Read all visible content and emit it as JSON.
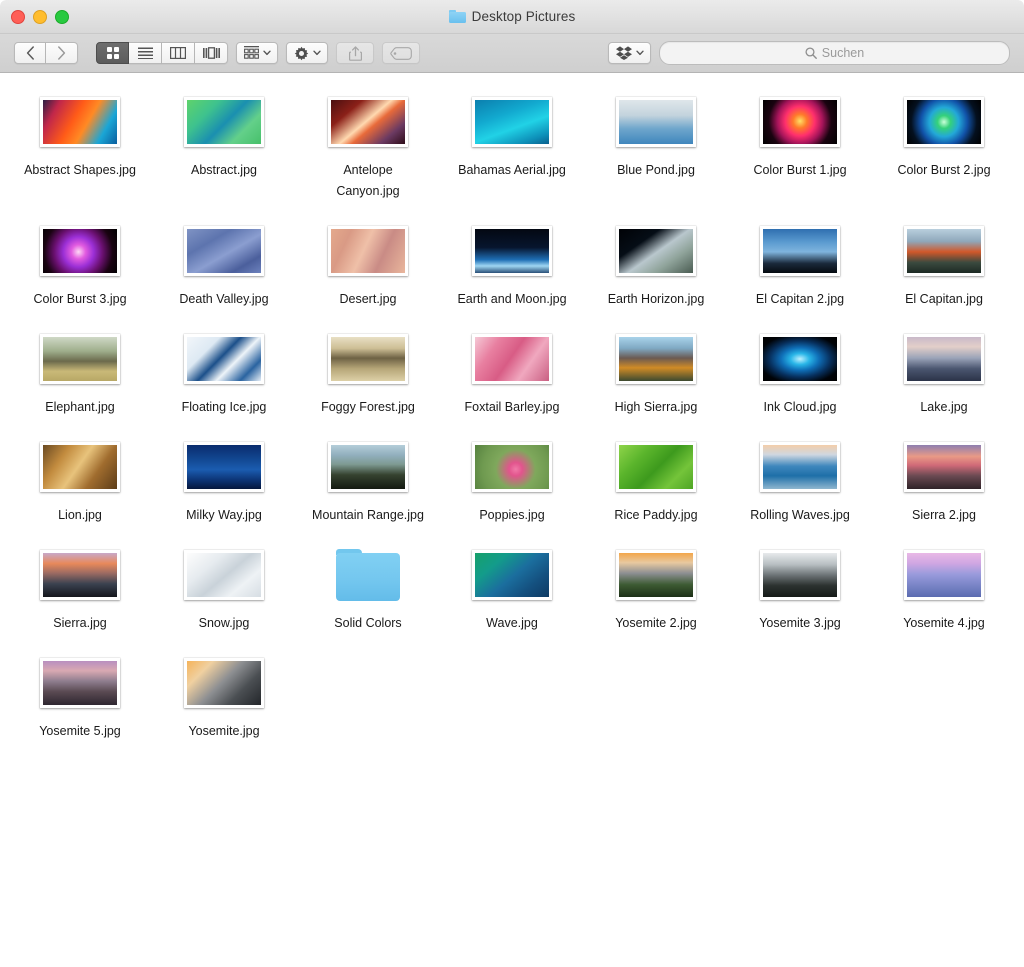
{
  "window": {
    "title": "Desktop Pictures",
    "traffic_lights": [
      "close",
      "minimize",
      "maximize"
    ]
  },
  "toolbar": {
    "back_label": "‹",
    "forward_label": "›",
    "view_modes": [
      {
        "name": "icon-view",
        "selected": true
      },
      {
        "name": "list-view",
        "selected": false
      },
      {
        "name": "column-view",
        "selected": false
      },
      {
        "name": "coverflow-view",
        "selected": false
      }
    ],
    "arrange_label": "",
    "action_label": "",
    "share_label": "",
    "tags_label": "",
    "dropbox_label": ""
  },
  "search": {
    "placeholder": "Suchen"
  },
  "files": [
    {
      "name": "Abstract Shapes.jpg",
      "type": "image",
      "css": "linear-gradient(120deg,#2b1e44 0%,#c1274a 18%,#ff5b18 42%,#ff8a24 58%,#1aa6d6 80%,#0b5e9e 100%)"
    },
    {
      "name": "Abstract.jpg",
      "type": "image",
      "css": "linear-gradient(135deg,#5fd36b 0%,#3ec28e 28%,#1a8fb0 52%,#63d08a 74%,#47c06a 100%)"
    },
    {
      "name": "Antelope Canyon.jpg",
      "type": "image",
      "css": "linear-gradient(140deg,#4a0f10 0%,#8b2018 25%,#ffd9b0 48%,#e86a3a 58%,#6b3a62 80%,#2e0c18 100%)"
    },
    {
      "name": "Bahamas Aerial.jpg",
      "type": "image",
      "css": "linear-gradient(160deg,#0b7fae 0%,#12a9cf 35%,#21d2e6 60%,#0d8fb8 85%,#0a5f8d 100%)"
    },
    {
      "name": "Blue Pond.jpg",
      "type": "image",
      "css": "linear-gradient(to bottom,#dfe6ea 0%,#c3d3dd 35%,#6fa6cc 65%,#3f86bd 100%)"
    },
    {
      "name": "Color Burst 1.jpg",
      "type": "image",
      "css": "radial-gradient(circle at 50% 48%, #ffe066 0%, #ff7a2a 16%, #ff2f6d 34%, #a5145a 52%, #1a0310 72%, #000000 100%)"
    },
    {
      "name": "Color Burst 2.jpg",
      "type": "image",
      "css": "radial-gradient(circle at 50% 50%, #c9ffd8 0%, #35d17a 15%, #23a8d8 34%, #1152a8 54%, #04101f 76%, #000000 100%)"
    },
    {
      "name": "Color Burst 3.jpg",
      "type": "image",
      "css": "radial-gradient(circle at 48% 52%, #ffd9f5 0%, #e25ce0 16%, #9b2fd6 34%, #6a1070 54%, #1a0312 76%, #000000 100%)"
    },
    {
      "name": "Death Valley.jpg",
      "type": "image",
      "css": "linear-gradient(150deg,#7f93c4 0%,#5d74ae 30%,#8b9ed0 55%,#4b5f9c 80%,#6d82bd 100%)"
    },
    {
      "name": "Desert.jpg",
      "type": "image",
      "css": "linear-gradient(115deg,#e4a98c 0%,#d99a85 22%,#efc0a8 45%,#c98b85 68%,#e9b69c 100%)"
    },
    {
      "name": "Earth and Moon.jpg",
      "type": "image",
      "css": "linear-gradient(to bottom,#030812 0%,#07152e 42%,#1f6fb5 70%,#9fd6f2 84%,#2a4f78 100%)"
    },
    {
      "name": "Earth Horizon.jpg",
      "type": "image",
      "css": "linear-gradient(145deg,#000206 0%,#050d16 30%,#b9c7cd 52%,#8fa39a 72%,#4a5c52 100%)"
    },
    {
      "name": "El Capitan 2.jpg",
      "type": "image",
      "css": "linear-gradient(to bottom,#2f6fb0 0%,#5b9bd0 30%,#7fb4dd 52%,#1b2a3c 78%,#050a10 100%)"
    },
    {
      "name": "El Capitan.jpg",
      "type": "image",
      "css": "linear-gradient(to bottom,#b9cfdd 0%,#8fa8bb 28%,#d1582a 52%,#3b4a3f 76%,#1d2a24 100%)"
    },
    {
      "name": "Elephant.jpg",
      "type": "image",
      "css": "linear-gradient(to bottom,#cfd8c6 0%,#9fae8c 32%,#6b6a4c 55%,#c9b978 78%,#b8a866 100%)"
    },
    {
      "name": "Floating Ice.jpg",
      "type": "image",
      "css": "linear-gradient(135deg,#f2f6fa 0%,#dde9f3 28%,#1b4f8a 46%,#eef4f9 62%,#2a63a0 82%,#e7eff7 100%)"
    },
    {
      "name": "Foggy Forest.jpg",
      "type": "image",
      "css": "linear-gradient(to bottom,#e8dfc4 0%,#cdbe95 26%,#6e6244 48%,#b6a678 72%,#ddd0a7 100%)"
    },
    {
      "name": "Foxtail Barley.jpg",
      "type": "image",
      "css": "linear-gradient(125deg,#f5c9d6 0%,#e87fa0 25%,#d85c85 48%,#f0a8bf 70%,#c95f82 100%)"
    },
    {
      "name": "High Sierra.jpg",
      "type": "image",
      "css": "linear-gradient(to bottom,#a9d3ea 0%,#7fa8c2 26%,#6b5a52 48%,#d08b26 70%,#3c4a30 100%)"
    },
    {
      "name": "Ink Cloud.jpg",
      "type": "image",
      "css": "radial-gradient(ellipse at 50% 50%, #bff0ff 0%, #29b6e8 18%, #0f6fb8 36%, #07305e 58%, #000308 80%, #000000 100%)"
    },
    {
      "name": "Lake.jpg",
      "type": "image",
      "css": "linear-gradient(to bottom,#c9b9c9 0%,#e3cfc9 22%,#9aa3b8 48%,#4b5670 72%,#2b3348 100%)"
    },
    {
      "name": "Lion.jpg",
      "type": "image",
      "css": "linear-gradient(125deg,#6a4a22 0%,#c28b3e 26%,#e8c37c 48%,#a06c2e 70%,#5c3c18 100%)"
    },
    {
      "name": "Milky Way.jpg",
      "type": "image",
      "css": "linear-gradient(to bottom,#0a2c6e 0%,#11458f 30%,#1b5cb0 56%,#0c3374 80%,#05163c 100%)"
    },
    {
      "name": "Mountain Range.jpg",
      "type": "image",
      "css": "linear-gradient(to bottom,#b4cdd9 0%,#90aebc 24%,#7e9a92 44%,#35422f 68%,#141a11 100%)"
    },
    {
      "name": "Poppies.jpg",
      "type": "image",
      "css": "radial-gradient(circle at 55% 55%, #f07aa8 0%, #e2548d 14%, #7fa85c 42%, #6f9a50 70%, #55803e 100%)"
    },
    {
      "name": "Rice Paddy.jpg",
      "type": "image",
      "css": "linear-gradient(135deg,#8fd44a 0%,#5bb52c 28%,#3d9a1d 52%,#74c43a 76%,#4ea524 100%)"
    },
    {
      "name": "Rolling Waves.jpg",
      "type": "image",
      "css": "linear-gradient(to bottom,#f3cdaa 0%,#cfd7e0 22%,#3f87bd 48%,#1e6fa8 70%,#8fb6cf 100%)"
    },
    {
      "name": "Sierra 2.jpg",
      "type": "image",
      "css": "linear-gradient(to bottom,#8e7fb0 0%,#e99a86 26%,#d06a78 46%,#6b4a52 70%,#2f2228 100%)"
    },
    {
      "name": "Sierra.jpg",
      "type": "image",
      "css": "linear-gradient(to bottom,#c9a8c8 0%,#e8895a 24%,#9b6a62 46%,#3b4250 70%,#14161c 100%)"
    },
    {
      "name": "Snow.jpg",
      "type": "image",
      "css": "linear-gradient(140deg,#fdfdfd 0%,#e6ebef 30%,#c9d2d9 52%,#eef2f5 74%,#d6dde3 100%)"
    },
    {
      "name": "Solid Colors",
      "type": "folder",
      "css": ""
    },
    {
      "name": "Wave.jpg",
      "type": "image",
      "css": "linear-gradient(140deg,#17a06a 0%,#139c8a 26%,#1b6e9e 52%,#14507f 76%,#0e3a63 100%)"
    },
    {
      "name": "Yosemite 2.jpg",
      "type": "image",
      "css": "linear-gradient(to bottom,#f3a64a 0%,#e8c9a0 22%,#8d8f92 46%,#3d5b33 72%,#1c2f16 100%)"
    },
    {
      "name": "Yosemite 3.jpg",
      "type": "image",
      "css": "linear-gradient(to bottom,#e7eaec 0%,#b8bfc2 26%,#6d7477 50%,#2c3230 74%,#151a17 100%)"
    },
    {
      "name": "Yosemite 4.jpg",
      "type": "image",
      "css": "linear-gradient(to bottom,#e9b8e6 0%,#cfa6e2 24%,#9a9bdc 48%,#7b86c8 72%,#5b6bb0 100%)"
    },
    {
      "name": "Yosemite 5.jpg",
      "type": "image",
      "css": "linear-gradient(to bottom,#b98fc0 0%,#d9a9b2 22%,#8e7d8e 46%,#5a4a52 70%,#2e2630 100%)"
    },
    {
      "name": "Yosemite.jpg",
      "type": "image",
      "css": "linear-gradient(135deg,#f5b35a 0%,#f0d0a0 22%,#8d8f92 48%,#4a4e52 72%,#23262a 100%)"
    }
  ]
}
